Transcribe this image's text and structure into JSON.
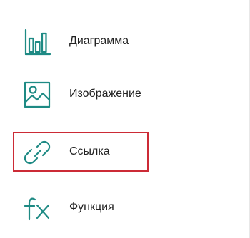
{
  "menu": {
    "items": [
      {
        "label": "Диаграмма",
        "icon": "bar-chart-icon"
      },
      {
        "label": "Изображение",
        "icon": "image-icon"
      },
      {
        "label": "Ссылка",
        "icon": "link-icon"
      },
      {
        "label": "Функция",
        "icon": "function-fx-icon"
      }
    ],
    "highlighted_item": "Ссылка"
  },
  "colors": {
    "icon_teal": "#1e8a84",
    "text": "#222222",
    "highlight_border": "#cc2b36",
    "background": "#ffffff"
  }
}
